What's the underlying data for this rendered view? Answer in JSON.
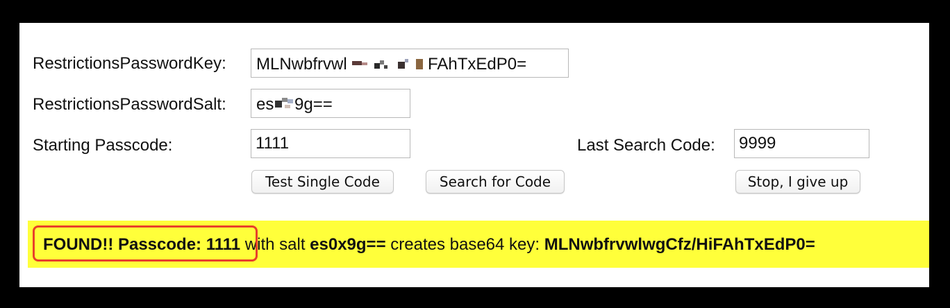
{
  "form": {
    "key_label": "RestrictionsPasswordKey:",
    "key_value": "MLNwbfrvwl",
    "key_value_tail": "FAhTxEdP0=",
    "salt_label": "RestrictionsPasswordSalt:",
    "salt_value": "es",
    "salt_value_tail": "9g==",
    "start_label": "Starting Passcode:",
    "start_value": "1111",
    "last_label": "Last Search Code:",
    "last_value": "9999"
  },
  "buttons": {
    "test_single": "Test Single Code",
    "search": "Search for Code",
    "stop": "Stop, I give up"
  },
  "result": {
    "found": "FOUND!! Passcode: 1111",
    "with_salt": " with salt ",
    "salt": "es0x9g==",
    "creates": " creates base64 key: ",
    "key": "MLNwbfrvwlwgCfz/HiFAhTxEdP0="
  },
  "colors": {
    "result_background": "#ffff3a",
    "highlight_border": "#e8402a"
  }
}
